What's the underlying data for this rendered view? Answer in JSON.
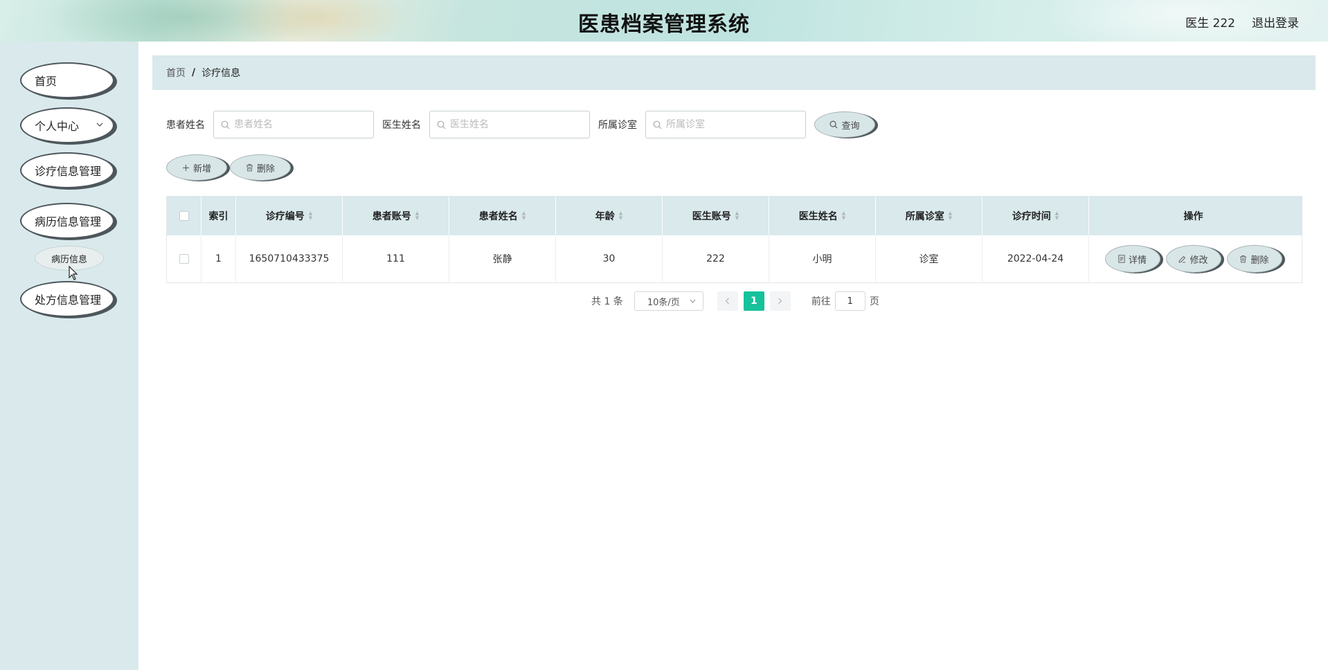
{
  "header": {
    "title": "医患档案管理系统",
    "user_label": "医生 222",
    "logout_label": "退出登录"
  },
  "sidebar": {
    "items": [
      {
        "label": "首页"
      },
      {
        "label": "个人中心"
      },
      {
        "label": "诊疗信息管理"
      },
      {
        "label": "病历信息管理"
      },
      {
        "label": "处方信息管理"
      }
    ],
    "submenu_item": "病历信息"
  },
  "breadcrumb": {
    "home": "首页",
    "separator": "/",
    "current": "诊疗信息"
  },
  "search": {
    "patient_name_label": "患者姓名",
    "patient_name_placeholder": "患者姓名",
    "doctor_name_label": "医生姓名",
    "doctor_name_placeholder": "医生姓名",
    "clinic_label": "所属诊室",
    "clinic_placeholder": "所属诊室",
    "search_button": "查询"
  },
  "actions": {
    "add_button": "新增",
    "delete_button": "删除"
  },
  "table": {
    "columns": [
      "索引",
      "诊疗编号",
      "患者账号",
      "患者姓名",
      "年龄",
      "医生账号",
      "医生姓名",
      "所属诊室",
      "诊疗时间",
      "操作"
    ],
    "rows": [
      {
        "index": "1",
        "treatment_no": "1650710433375",
        "patient_account": "111",
        "patient_name": "张静",
        "age": "30",
        "doctor_account": "222",
        "doctor_name": "小明",
        "clinic": "诊室",
        "treatment_time": "2022-04-24",
        "ops": {
          "detail": "详情",
          "edit": "修改",
          "delete": "删除"
        }
      }
    ]
  },
  "pagination": {
    "total_text": "共 1 条",
    "page_size": "10条/页",
    "current_page": "1",
    "goto_label": "前往",
    "goto_value": "1",
    "page_suffix": "页"
  },
  "colors": {
    "sidebar_bg": "#d9e9ec",
    "accent": "#16c29b",
    "pill_border": "#4d575c"
  }
}
